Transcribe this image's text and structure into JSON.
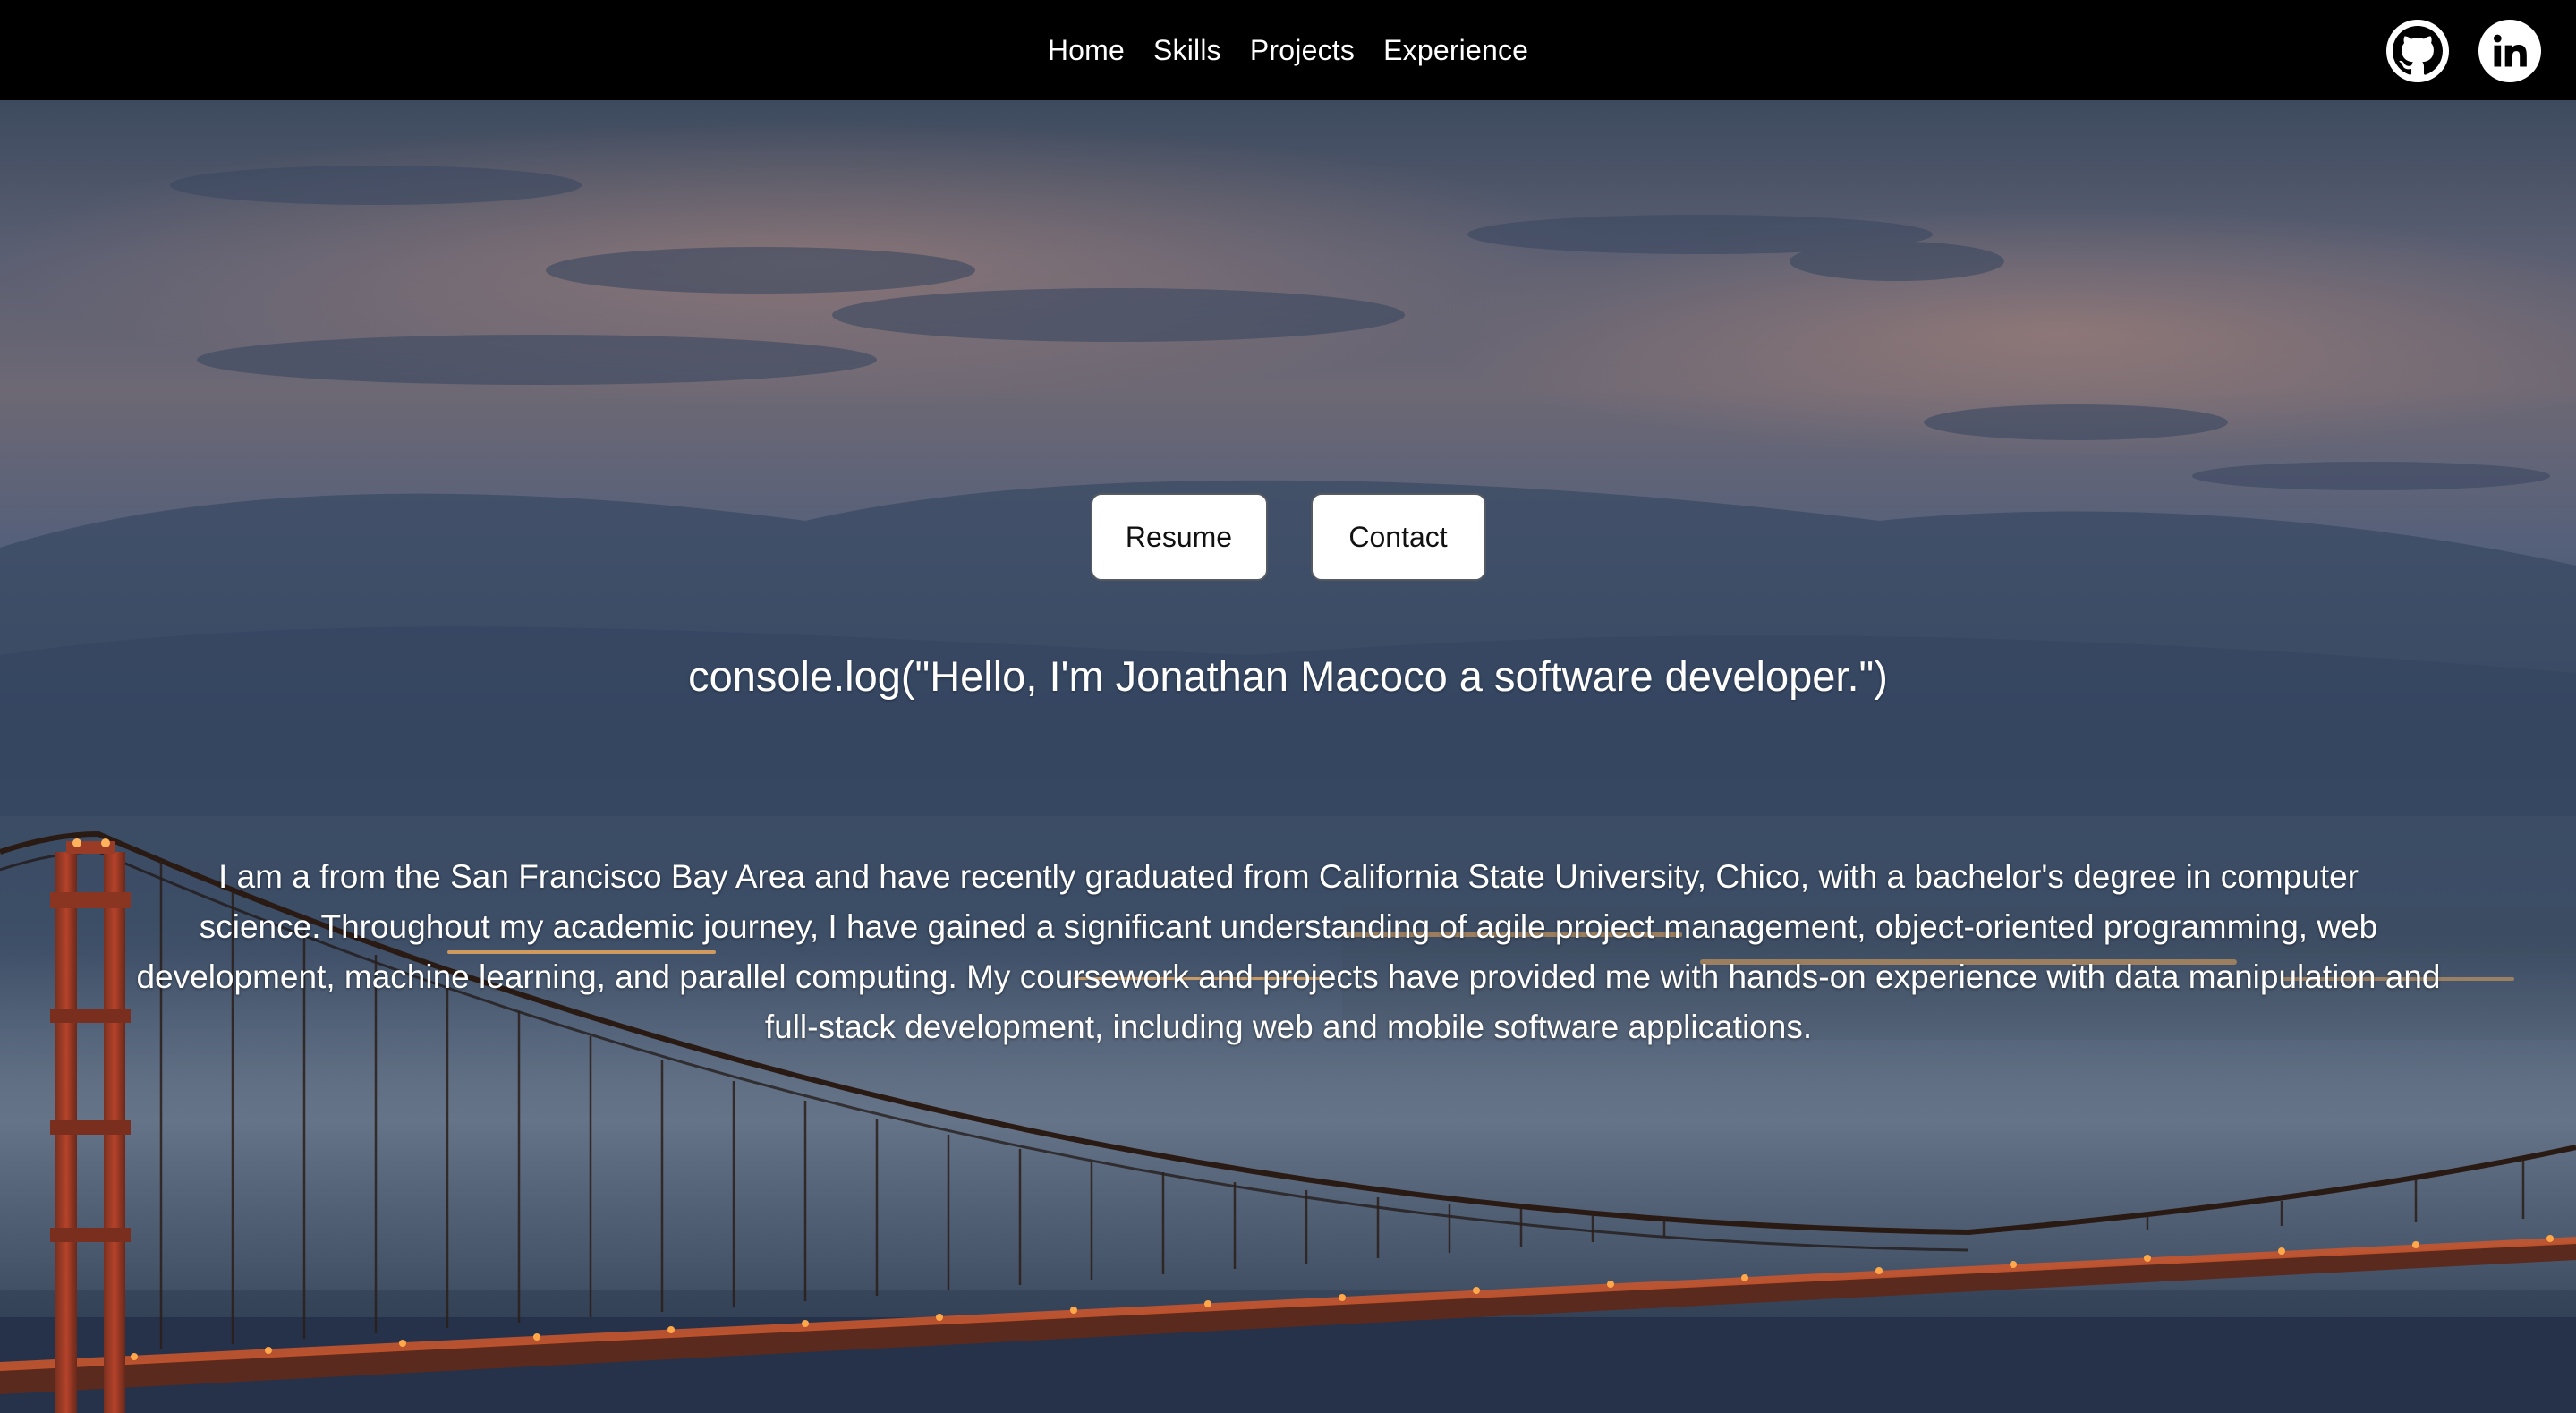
{
  "nav": {
    "links": [
      "Home",
      "Skills",
      "Projects",
      "Experience"
    ],
    "social": [
      {
        "icon": "github-icon"
      },
      {
        "icon": "linkedin-icon"
      }
    ]
  },
  "hero": {
    "buttons": {
      "resume_label": "Resume",
      "contact_label": "Contact"
    },
    "headline": "console.log(\"Hello, I'm Jonathan Macoco a software developer.\")",
    "bio": "I am a from the San Francisco Bay Area and have recently graduated from California State University, Chico, with a bachelor's degree in computer science.Throughout my academic journey, I have gained a significant understanding of agile project management, object-oriented programming, web development, machine learning, and parallel computing. My coursework and projects have provided me with hands-on experience with data manipulation and full-stack development, including web and mobile software applications."
  },
  "colors": {
    "navbar_bg": "#000000",
    "text": "#ffffff",
    "button_bg": "#ffffff",
    "bridge_red": "#b5432a",
    "bridge_lights": "#ff9a3c"
  }
}
